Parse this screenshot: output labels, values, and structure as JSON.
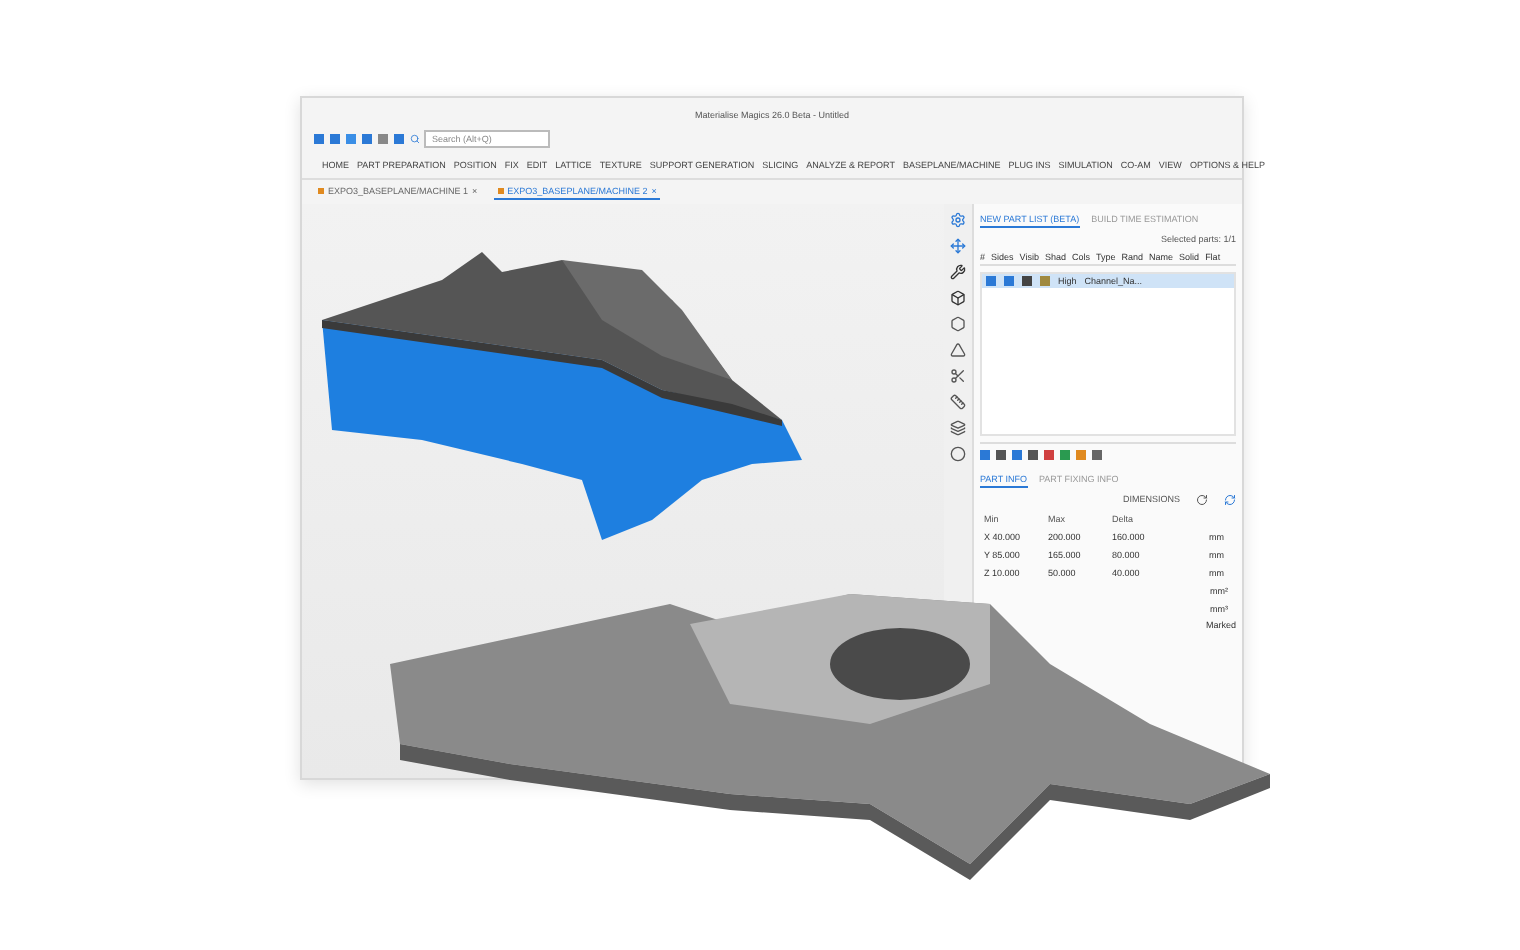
{
  "window": {
    "title": "Materialise Magics 26.0 Beta - Untitled"
  },
  "quick_access": {
    "search": {
      "placeholder": "Search (Alt+Q)"
    }
  },
  "menu": [
    "HOME",
    "PART PREPARATION",
    "POSITION",
    "FIX",
    "EDIT",
    "LATTICE",
    "TEXTURE",
    "SUPPORT GENERATION",
    "SLICING",
    "ANALYZE & REPORT",
    "BASEPLANE/MACHINE",
    "PLUG INS",
    "SIMULATION",
    "CO-AM",
    "VIEW",
    "OPTIONS & HELP"
  ],
  "document_tabs": [
    {
      "label": "EXPO3_BASEPLANE/MACHINE 1",
      "close": "×",
      "selected": false
    },
    {
      "label": "EXPO3_BASEPLANE/MACHINE 2",
      "close": "×",
      "selected": true
    }
  ],
  "part_list": {
    "tabs": [
      {
        "label": "NEW PART LIST (BETA)",
        "selected": true
      },
      {
        "label": "BUILD TIME ESTIMATION",
        "selected": false
      }
    ],
    "selected_parts": "Selected parts: 1/1",
    "columns": [
      "#",
      "Sides",
      "Visib",
      "Shad",
      "Cols",
      "Type",
      "Rand",
      "Name"
    ],
    "extra_columns": [
      "Solid",
      "Flat"
    ],
    "rows": [
      {
        "quality": "High",
        "name": "Channel_Na...",
        "selected": true
      }
    ]
  },
  "part_info": {
    "tabs": [
      {
        "label": "PART INFO",
        "selected": true
      },
      {
        "label": "PART FIXING INFO",
        "selected": false
      }
    ],
    "section": "DIMENSIONS",
    "columns": [
      "Min",
      "Max",
      "Delta"
    ],
    "rows": [
      {
        "axis": "X",
        "min": "40.000",
        "max": "200.000",
        "delta": "160.000",
        "unit": "mm"
      },
      {
        "axis": "Y",
        "min": "85.000",
        "max": "165.000",
        "delta": "80.000",
        "unit": "mm"
      },
      {
        "axis": "Z",
        "min": "10.000",
        "max": "50.000",
        "delta": "40.000",
        "unit": "mm"
      }
    ],
    "units": [
      "mm²",
      "mm³"
    ],
    "marked": "Marked"
  }
}
